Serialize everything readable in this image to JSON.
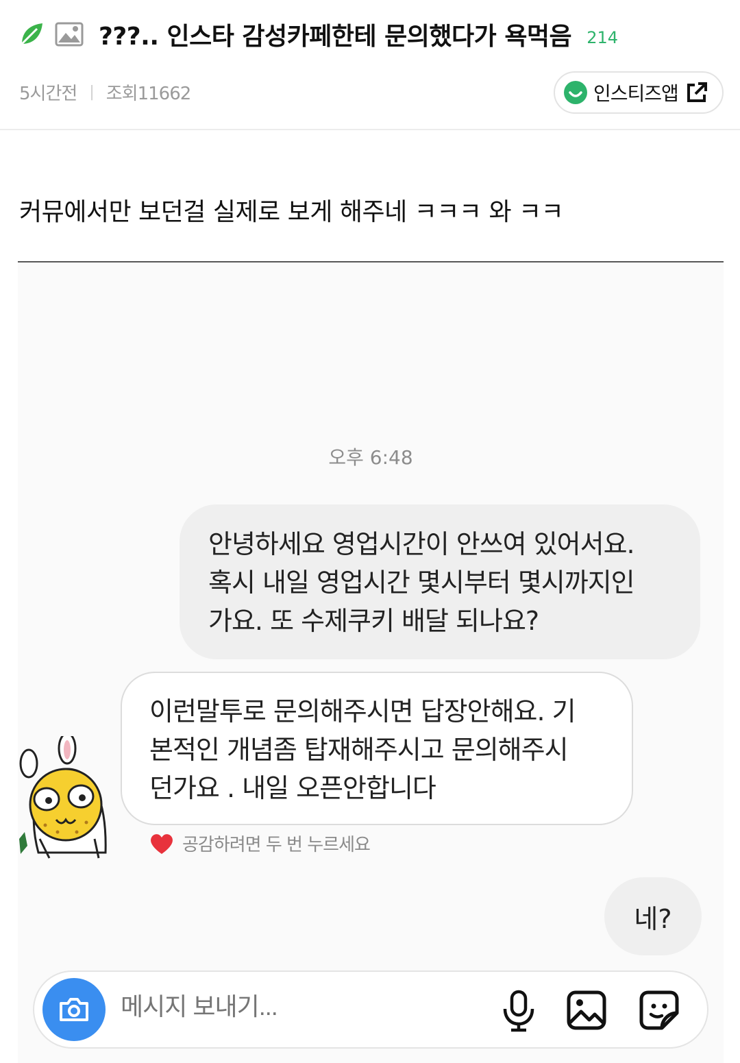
{
  "post": {
    "title": "???.. 인스타 감성카페한테 문의했다가 욕먹음",
    "comment_count": "214",
    "time_ago": "5시간전",
    "meta_separator": "|",
    "views": "조회11662",
    "app_button_label": "인스티즈앱",
    "body_text": "커뮤에서만 보던걸 실제로 보게 해주네 ㅋㅋㅋ 와 ㅋㅋ"
  },
  "chat": {
    "timestamp": "오후 6:48",
    "sent_message": {
      "line1": "안녕하세요 영업시간이 안쓰여 있어서요.",
      "line2": "혹시 내일 영업시간 몇시부터 몇시까지인",
      "line3": "가요. 또 수제쿠키 배달 되나요?"
    },
    "received_message": {
      "line1": "이런말투로 문의해주시면 답장안해요. 기",
      "line2": "본적인 개념좀 탑재해주시고 문의해주시",
      "line3": "던가요 . 내일 오픈안합니다"
    },
    "like_hint": "공감하려면 두 번 누르세요",
    "reply_message": "네?",
    "composer_placeholder": "메시지 보내기..."
  },
  "colors": {
    "accent_green": "#2db36b",
    "camera_blue": "#3a8ef0",
    "heart_red": "#e8323c",
    "bubble_gray": "#efefef"
  },
  "icons": [
    "leaf-icon",
    "image-icon",
    "smile-icon",
    "external-link-icon",
    "avatar",
    "heart-icon",
    "camera-icon",
    "mic-icon",
    "gallery-icon",
    "sticker-icon"
  ]
}
